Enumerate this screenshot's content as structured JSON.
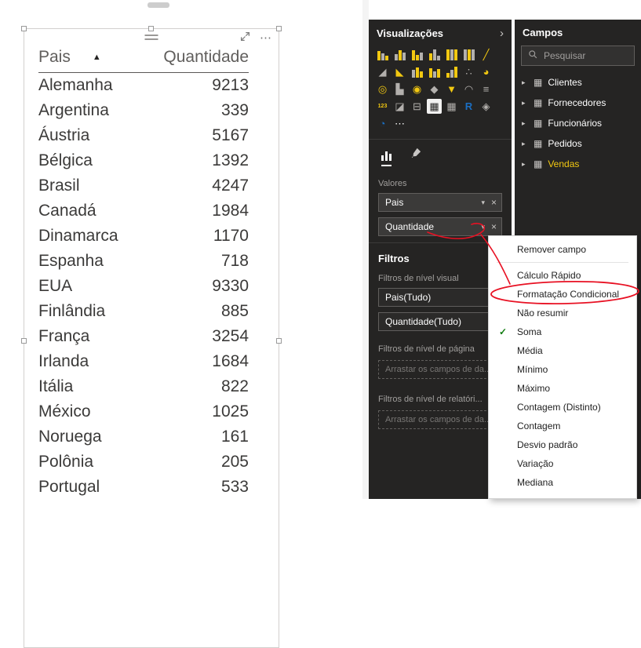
{
  "canvas": {
    "visual": {
      "more_options_icon": "⋯",
      "table": {
        "header": {
          "country": "Pais",
          "sort_icon": "▲",
          "quantity": "Quantidade"
        },
        "rows": [
          {
            "country": "Alemanha",
            "quantity": "9213"
          },
          {
            "country": "Argentina",
            "quantity": "339"
          },
          {
            "country": "Áustria",
            "quantity": "5167"
          },
          {
            "country": "Bélgica",
            "quantity": "1392"
          },
          {
            "country": "Brasil",
            "quantity": "4247"
          },
          {
            "country": "Canadá",
            "quantity": "1984"
          },
          {
            "country": "Dinamarca",
            "quantity": "1170"
          },
          {
            "country": "Espanha",
            "quantity": "718"
          },
          {
            "country": "EUA",
            "quantity": "9330"
          },
          {
            "country": "Finlândia",
            "quantity": "885"
          },
          {
            "country": "França",
            "quantity": "3254"
          },
          {
            "country": "Irlanda",
            "quantity": "1684"
          },
          {
            "country": "Itália",
            "quantity": "822"
          },
          {
            "country": "México",
            "quantity": "1025"
          },
          {
            "country": "Noruega",
            "quantity": "161"
          },
          {
            "country": "Polônia",
            "quantity": "205"
          },
          {
            "country": "Portugal",
            "quantity": "533"
          }
        ]
      }
    }
  },
  "visualizations_panel": {
    "title": "Visualizações",
    "collapse_icon": "›",
    "values_label": "Valores",
    "well_caret": "▾",
    "well_remove": "×",
    "wells": [
      {
        "label": "Pais"
      },
      {
        "label": "Quantidade",
        "annotated": true
      }
    ],
    "icons": [
      {
        "name": "stacked-bar-chart",
        "kind": "bars",
        "bars": [
          12,
          9,
          6
        ],
        "colors": [
          "#F2C811",
          "#B3B0AD",
          "#F2C811"
        ]
      },
      {
        "name": "stacked-column-chart",
        "kind": "bars",
        "bars": [
          8,
          13,
          10
        ],
        "colors": [
          "#B3B0AD",
          "#F2C811",
          "#B3B0AD"
        ]
      },
      {
        "name": "clustered-bar-chart",
        "kind": "bars",
        "bars": [
          13,
          7,
          10
        ],
        "colors": [
          "#F2C811",
          "#F2C811",
          "#B3B0AD"
        ]
      },
      {
        "name": "clustered-column-chart",
        "kind": "bars",
        "bars": [
          9,
          14,
          6
        ],
        "colors": [
          "#F2C811",
          "#B3B0AD",
          "#B3B0AD"
        ]
      },
      {
        "name": "100-stacked-bar-chart",
        "kind": "bars",
        "bars": [
          14,
          14,
          14
        ],
        "colors": [
          "#F2C811",
          "#B3B0AD",
          "#F2C811"
        ]
      },
      {
        "name": "100-stacked-column-chart",
        "kind": "bars",
        "bars": [
          14,
          14,
          14
        ],
        "colors": [
          "#B3B0AD",
          "#F2C811",
          "#B3B0AD"
        ]
      },
      {
        "name": "line-chart",
        "kind": "glyph",
        "glyph": "╱",
        "color": "#F2C811"
      },
      {
        "name": "area-chart",
        "kind": "glyph",
        "glyph": "◢",
        "color": "#B3B0AD"
      },
      {
        "name": "stacked-area-chart",
        "kind": "glyph",
        "glyph": "◣",
        "color": "#F2C811"
      },
      {
        "name": "line-and-stacked-column-chart",
        "kind": "bars",
        "bars": [
          10,
          13,
          8
        ],
        "colors": [
          "#B3B0AD",
          "#F2C811",
          "#F2C811"
        ]
      },
      {
        "name": "line-and-clustered-column-chart",
        "kind": "bars",
        "bars": [
          12,
          8,
          11
        ],
        "colors": [
          "#F2C811",
          "#B3B0AD",
          "#F2C811"
        ]
      },
      {
        "name": "waterfall-chart",
        "kind": "bars",
        "bars": [
          6,
          10,
          14
        ],
        "colors": [
          "#F2C811",
          "#B3B0AD",
          "#F2C811"
        ]
      },
      {
        "name": "scatter-chart",
        "kind": "glyph",
        "glyph": "∴",
        "color": "#B3B0AD"
      },
      {
        "name": "pie-chart",
        "kind": "glyph",
        "glyph": "◕",
        "color": "#F2C811"
      },
      {
        "name": "donut-chart",
        "kind": "glyph",
        "glyph": "◎",
        "color": "#F2C811"
      },
      {
        "name": "treemap",
        "kind": "glyph",
        "glyph": "▙",
        "color": "#B3B0AD"
      },
      {
        "name": "map",
        "kind": "glyph",
        "glyph": "◉",
        "color": "#F2C811"
      },
      {
        "name": "filled-map",
        "kind": "glyph",
        "glyph": "◆",
        "color": "#B3B0AD"
      },
      {
        "name": "funnel-chart",
        "kind": "glyph",
        "glyph": "▼",
        "color": "#F2C811"
      },
      {
        "name": "gauge",
        "kind": "glyph",
        "glyph": "◠",
        "color": "#B3B0AD"
      },
      {
        "name": "multi-row-card",
        "kind": "glyph",
        "glyph": "≡",
        "color": "#B3B0AD"
      },
      {
        "name": "card",
        "kind": "glyph",
        "glyph": "123",
        "color": "#F2C811",
        "small": true
      },
      {
        "name": "kpi",
        "kind": "glyph",
        "glyph": "◪",
        "color": "#B3B0AD"
      },
      {
        "name": "slicer",
        "kind": "glyph",
        "glyph": "⊟",
        "color": "#B3B0AD"
      },
      {
        "name": "table",
        "kind": "glyph",
        "glyph": "▦",
        "color": "#252423",
        "selected": true
      },
      {
        "name": "matrix",
        "kind": "glyph",
        "glyph": "▦",
        "color": "#B3B0AD"
      },
      {
        "name": "r-script-visual",
        "kind": "glyph",
        "glyph": "R",
        "color": "#1B6EC2",
        "bold": true
      },
      {
        "name": "shape-map",
        "kind": "glyph",
        "glyph": "◈",
        "color": "#B3B0AD"
      },
      {
        "name": "arcgis-map",
        "kind": "glyph",
        "glyph": "◔",
        "color": "#1B6EC2"
      },
      {
        "name": "more-visuals",
        "kind": "glyph",
        "glyph": "⋯",
        "color": "#FFFFFF"
      }
    ],
    "filters": {
      "title": "Filtros",
      "visual_level_label": "Filtros de nível visual",
      "wells": [
        {
          "label": "Pais(Tudo)"
        },
        {
          "label": "Quantidade(Tudo)"
        }
      ],
      "page_level_label": "Filtros de nível de página",
      "page_drop_hint": "Arrastar os campos de da...",
      "report_level_label": "Filtros de nível de relatóri...",
      "report_drop_hint": "Arrastar os campos de da..."
    }
  },
  "fields_panel": {
    "title": "Campos",
    "search_placeholder": "Pesquisar",
    "expand_icon": "▸",
    "table_icon": "▦",
    "tables": [
      {
        "name": "Clientes"
      },
      {
        "name": "Fornecedores"
      },
      {
        "name": "Funcionários"
      },
      {
        "name": "Pedidos"
      },
      {
        "name": "Vendas",
        "highlighted": true
      }
    ]
  },
  "context_menu": {
    "check_icon": "✓",
    "items": [
      {
        "label": "Remover campo",
        "separator_after": true
      },
      {
        "label": "Cálculo Rápido"
      },
      {
        "label": "Formatação Condicional",
        "annotated": true
      },
      {
        "label": "Não resumir"
      },
      {
        "label": "Soma",
        "checked": true
      },
      {
        "label": "Média"
      },
      {
        "label": "Mínimo"
      },
      {
        "label": "Máximo"
      },
      {
        "label": "Contagem (Distinto)"
      },
      {
        "label": "Contagem"
      },
      {
        "label": "Desvio padrão"
      },
      {
        "label": "Variação"
      },
      {
        "label": "Mediana"
      }
    ]
  },
  "colors": {
    "accent": "#F2C811",
    "panel_bg": "#252423",
    "check_green": "#107C10",
    "annotation_red": "#E81123"
  }
}
